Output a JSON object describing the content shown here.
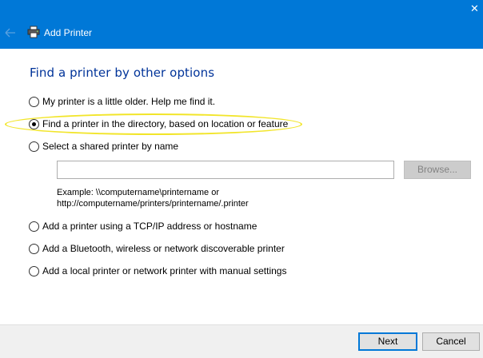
{
  "window": {
    "title": "Add Printer",
    "close_glyph": "✕",
    "back_glyph": "←"
  },
  "heading": "Find a printer by other options",
  "options": [
    {
      "label": "My printer is a little older. Help me find it.",
      "checked": false
    },
    {
      "label": "Find a printer in the directory, based on location or feature",
      "checked": true
    },
    {
      "label": "Select a shared printer by name",
      "checked": false
    },
    {
      "label": "Add a printer using a TCP/IP address or hostname",
      "checked": false
    },
    {
      "label": "Add a Bluetooth, wireless or network discoverable printer",
      "checked": false
    },
    {
      "label": "Add a local printer or network printer with manual settings",
      "checked": false
    }
  ],
  "shared_name": {
    "value": "",
    "placeholder": "",
    "browse_label": "Browse...",
    "example_line1": "Example: \\\\computername\\printername or",
    "example_line2": "http://computername/printers/printername/.printer"
  },
  "footer": {
    "next_label": "Next",
    "cancel_label": "Cancel"
  },
  "colors": {
    "titlebar": "#0078d7",
    "heading": "#003399",
    "highlight": "#f2e52a"
  },
  "icons": {
    "back": "back-arrow-icon",
    "printer": "printer-icon",
    "close": "close-icon"
  }
}
